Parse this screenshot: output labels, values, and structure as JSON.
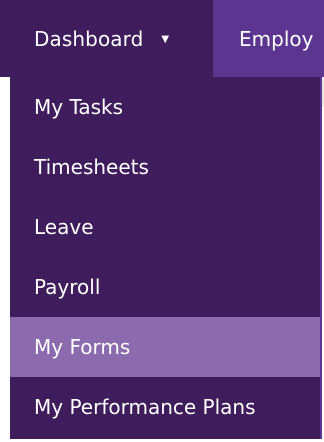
{
  "navbar": {
    "dashboard_label": "Dashboard",
    "caret_icon": "triangle-down",
    "employ_label": "Employ"
  },
  "menu": {
    "items": [
      {
        "label": "My Tasks",
        "active": false
      },
      {
        "label": "Timesheets",
        "active": false
      },
      {
        "label": "Leave",
        "active": false
      },
      {
        "label": "Payroll",
        "active": false
      },
      {
        "label": "My Forms",
        "active": true
      },
      {
        "label": "My Performance Plans",
        "active": false
      }
    ]
  },
  "colors": {
    "nav_background": "#3f1d5c",
    "nav_secondary": "#5b3590",
    "active_item": "#8b6aad",
    "text": "#ffffff"
  }
}
